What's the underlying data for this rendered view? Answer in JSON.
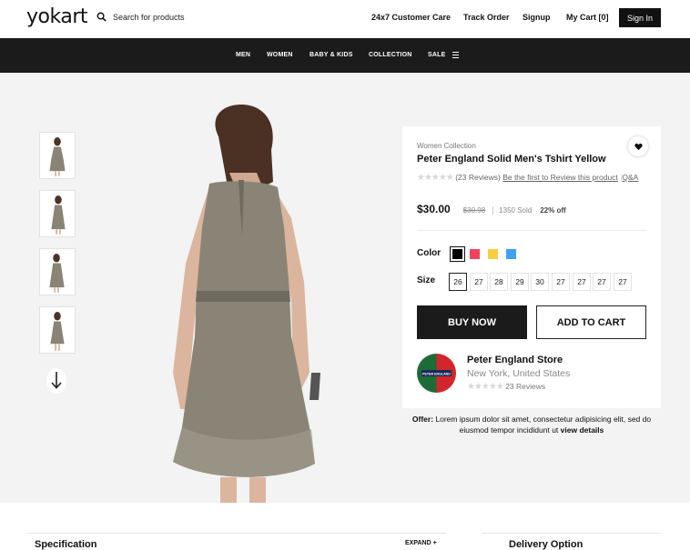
{
  "header": {
    "logo": "yokart",
    "search_placeholder": "Search for products",
    "links": [
      "24x7 Customer Care",
      "Track Order",
      "Signup",
      "My Cart [0]"
    ],
    "signin_label": "Sign In"
  },
  "nav": {
    "items": [
      "MEN",
      "WOMEN",
      "BABY & KIDS",
      "COLLECTION",
      "SALE"
    ]
  },
  "gallery": {
    "thumbnail_count": 4,
    "scroll_icon": "arrow-down-icon"
  },
  "product": {
    "collection": "Women Collection",
    "title": "Peter England Solid Men's Tshirt Yellow",
    "reviews": "(23 Reviews)",
    "review_link": "Be the first to Review this product",
    "qa_link": "Q&A",
    "price": "$30.00",
    "old_price": "$30.98",
    "sold": "1350 Sold",
    "discount": "22% off",
    "color_label": "Color",
    "colors": [
      "#000000",
      "#f0435d",
      "#f7ce3e",
      "#3da2f0"
    ],
    "selected_color_index": 0,
    "size_label": "Size",
    "sizes": [
      "26",
      "27",
      "28",
      "29",
      "30",
      "27",
      "27",
      "27",
      "27"
    ],
    "selected_size_index": 0,
    "buy_now": "BUY NOW",
    "add_to_cart": "ADD TO CART"
  },
  "store": {
    "logo_text": "PETER ENGLAND",
    "name": "Peter England Store",
    "location": "New York, United States",
    "reviews": "23 Reviews"
  },
  "offer": {
    "label": "Offer:",
    "text": " Lorem ipsum dolor sit amet, consectetur adipisicing elit, sed do eiusmod tempor incididunt ut ",
    "link": "view details"
  },
  "bottom": {
    "specification": "Specification",
    "expand": "EXPAND +",
    "delivery": "Delivery Option"
  },
  "colors": {
    "nav_bg": "#1b1b1b",
    "page_bg": "#f3f3f3",
    "dress": "#8a8476"
  }
}
